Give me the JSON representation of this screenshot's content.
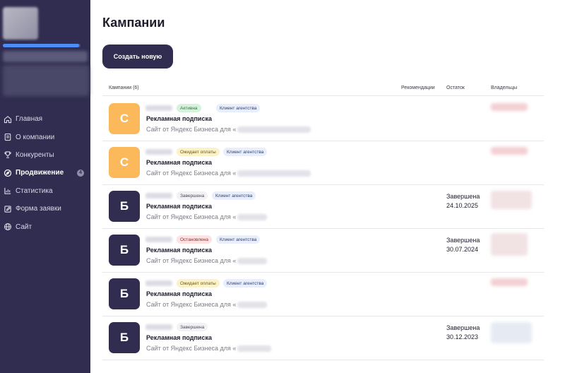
{
  "sidebar": {
    "progress": 0.98,
    "nav": [
      {
        "label": "Главная",
        "icon": "home-icon",
        "active": false
      },
      {
        "label": "О компании",
        "icon": "document-icon",
        "active": false
      },
      {
        "label": "Конкуренты",
        "icon": "trophy-icon",
        "active": false
      },
      {
        "label": "Продвижение",
        "icon": "promotion-icon",
        "active": true,
        "badge": "4"
      },
      {
        "label": "Статистика",
        "icon": "chart-icon",
        "active": false
      },
      {
        "label": "Форма заявки",
        "icon": "edit-form-icon",
        "active": false
      },
      {
        "label": "Сайт",
        "icon": "globe-icon",
        "active": false
      }
    ]
  },
  "main": {
    "title": "Кампании",
    "create_button": "Создать новую",
    "table": {
      "headers": {
        "campaigns": "Кампании (6)",
        "recommendations": "Рекомендации",
        "balance": "Остаток",
        "owners": "Владельцы"
      },
      "rows": [
        {
          "avatar": "С",
          "avatar_color": "#fbb95b",
          "status": "Активна",
          "status_style": "active",
          "tag": "Клиент агентства",
          "title": "Рекламная подписка",
          "subtitle": "Сайт от Яндекс Бизнеса для «",
          "end_title": "",
          "end_date": ""
        },
        {
          "avatar": "С",
          "avatar_color": "#fbb95b",
          "status": "Ожидает оплаты",
          "status_style": "waiting",
          "tag": "Клиент агентства",
          "title": "Рекламная подписка",
          "subtitle": "Сайт от Яндекс Бизнеса для «",
          "end_title": "",
          "end_date": ""
        },
        {
          "avatar": "Б",
          "avatar_color": "#302d50",
          "status": "Завершена",
          "status_style": "done",
          "tag": "Клиент агентства",
          "title": "Рекламная подписка",
          "subtitle": "Сайт от Яндекс Бизнеса для «",
          "end_title": "Завершена",
          "end_date": "24.10.2025"
        },
        {
          "avatar": "Б",
          "avatar_color": "#302d50",
          "status": "Остановлена",
          "status_style": "stopped",
          "tag": "Клиент агентства",
          "title": "Рекламная подписка",
          "subtitle": "Сайт от Яндекс Бизнеса для «",
          "end_title": "Завершена",
          "end_date": "30.07.2024"
        },
        {
          "avatar": "Б",
          "avatar_color": "#302d50",
          "status": "Ожидает оплаты",
          "status_style": "waiting",
          "tag": "Клиент агентства",
          "title": "Рекламная подписка",
          "subtitle": "Сайт от Яндекс Бизнеса для «",
          "end_title": "",
          "end_date": ""
        },
        {
          "avatar": "Б",
          "avatar_color": "#302d50",
          "status": "Завершена",
          "status_style": "done",
          "tag": "",
          "title": "Рекламная подписка",
          "subtitle": "Сайт от Яндекс Бизнеса для «",
          "end_title": "Завершена",
          "end_date": "30.12.2023"
        }
      ]
    }
  },
  "colors": {
    "sidebar_bg": "#302d50",
    "progress": "#4d8df5",
    "badge_active_bg": "#d7f2dc",
    "badge_active_text": "#2f7a3d",
    "badge_waiting_bg": "#fcf2c9",
    "badge_waiting_text": "#6b5a10",
    "badge_done_bg": "#f2f2f5",
    "badge_done_text": "#4a4a58",
    "badge_stopped_bg": "#fde3e3",
    "badge_stopped_text": "#8a2f2f",
    "badge_tag_bg": "#e8eefb",
    "badge_tag_text": "#2f3f6b"
  }
}
